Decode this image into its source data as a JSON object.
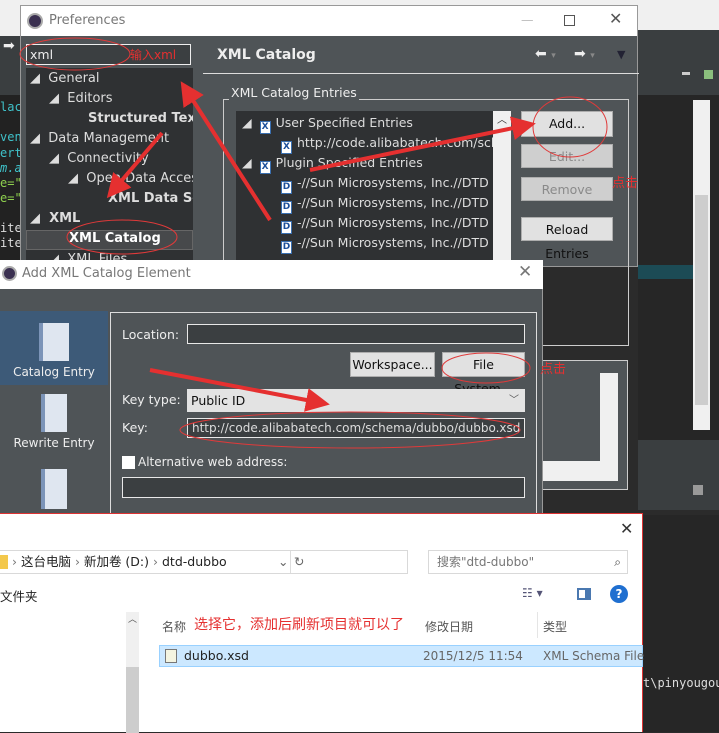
{
  "editor": {
    "code_lines": [
      {
        "text": "lac",
        "color": "#3fc1c9"
      },
      {
        "text": "ven",
        "color": "#3fc1c9"
      },
      {
        "text": "ert",
        "color": "#3fc1c9"
      },
      {
        "text": "m.a",
        "color": "#3fc1c9"
      },
      {
        "text": "e=\"",
        "color": "#8fd14f"
      },
      {
        "text": "e=\"",
        "color": "#8fd14f"
      },
      {
        "text": "ite",
        "color": "#ddd"
      },
      {
        "text": "ite",
        "color": "#ddd"
      }
    ],
    "console_text": "t\\pinyougou"
  },
  "preferences": {
    "title": "Preferences",
    "search_value": "xml",
    "tree": [
      {
        "label": "General",
        "level": 0
      },
      {
        "label": "Editors",
        "level": 1
      },
      {
        "label": "Structured Text E",
        "level": 3,
        "bold": true
      },
      {
        "label": "Data Management",
        "level": 0
      },
      {
        "label": "Connectivity",
        "level": 1
      },
      {
        "label": "Open Data Access",
        "level": 2
      },
      {
        "label": "XML Data Set",
        "level": 3,
        "bold": true
      },
      {
        "label": "XML",
        "level": 0
      },
      {
        "label": "XML Catalog",
        "level": 2,
        "bold": true,
        "selected": true
      },
      {
        "label": "XML Files",
        "level": 1
      }
    ],
    "page_title": "XML Catalog",
    "group_label": "XML Catalog Entries",
    "entries": [
      {
        "label": "User Specified Entries",
        "icon": "X",
        "level": 0
      },
      {
        "label": "http://code.alibabatech.com/schema",
        "icon": "X",
        "level": 1
      },
      {
        "label": "Plugin Specified Entries",
        "icon": "X",
        "level": 0
      },
      {
        "label": "-//Sun Microsystems, Inc.//DTD C",
        "icon": "D",
        "level": 1
      },
      {
        "label": "-//Sun Microsystems, Inc.//DTD E",
        "icon": "D",
        "level": 1
      },
      {
        "label": "-//Sun Microsystems, Inc.//DTD E",
        "icon": "D",
        "level": 1
      },
      {
        "label": "-//Sun Microsystems, Inc.//DTD F",
        "icon": "D",
        "level": 1
      }
    ],
    "buttons": {
      "add": "Add...",
      "edit": "Edit...",
      "remove": "Remove",
      "reload": "Reload Entries"
    }
  },
  "add_dialog": {
    "title": "Add XML Catalog Element",
    "sidebar": [
      {
        "label": "Catalog Entry",
        "selected": true
      },
      {
        "label": "Rewrite Entry"
      },
      {
        "label": ""
      }
    ],
    "location_label": "Location:",
    "location_value": "",
    "workspace_button": "Workspace...",
    "filesystem_button": "File System...",
    "key_type_label": "Key type:",
    "key_type_value": "Public ID",
    "key_label": "Key:",
    "key_value": "http://code.alibabatech.com/schema/dubbo/dubbo.xsd",
    "alt_label": "Alternative web address:",
    "alt_checked": false,
    "alt_value": ""
  },
  "file_dialog": {
    "breadcrumb": [
      "这台电脑",
      "新加卷 (D:)",
      "dtd-dubbo"
    ],
    "search_placeholder": "搜索\"dtd-dubbo\"",
    "toolbar_label": "文件夹",
    "columns": [
      "名称",
      "修改日期",
      "类型"
    ],
    "files": [
      {
        "name": "dubbo.xsd",
        "date": "2015/12/5 11:54",
        "type": "XML Schema File",
        "selected": true
      }
    ]
  },
  "annotations": {
    "type_xml": "输入xml",
    "click1": "点击",
    "click2": "点击",
    "select_hint": "选择它，添加后刷新项目就可以了",
    "color": "#e53030"
  }
}
